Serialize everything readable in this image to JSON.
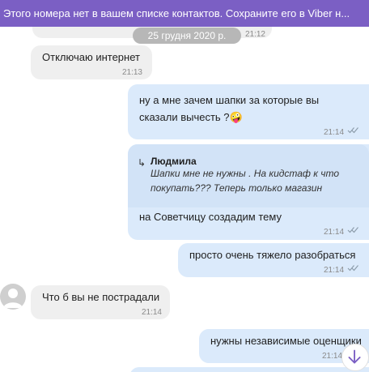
{
  "banner": {
    "text": "Этого номера нет в вашем списке контактов. Сохраните его в Viber н..."
  },
  "date_separator": "25 грудня 2020 р.",
  "messages": [
    {
      "direction": "in",
      "text": "",
      "time": "21:12"
    },
    {
      "direction": "in",
      "text": "Отключаю интернет",
      "time": "21:13"
    },
    {
      "direction": "out",
      "line1": "ну а мне зачем шапки за которые вы",
      "line2": "сказали вычесть ?",
      "emoji": "🤪",
      "time": "21:14"
    },
    {
      "direction": "out",
      "quote_author": "Людмила",
      "quote_text": "Шапки мне не нужны . На кидстаф к что покупать??? Теперь только магазин",
      "text": "на Советчицу создадим тему",
      "time": "21:14"
    },
    {
      "direction": "out",
      "text": "просто очень тяжело разобраться",
      "time": "21:14"
    },
    {
      "direction": "in",
      "text": "Что б вы не пострадали",
      "time": "21:14"
    },
    {
      "direction": "out",
      "text": "нужны независимые оценщики",
      "time": "21:14"
    }
  ],
  "colors": {
    "banner": "#7b5fc4",
    "incoming_bubble": "#efefef",
    "outgoing_bubble": "#dbeafb"
  },
  "icons": {
    "delivered": "double-check-icon",
    "scroll": "arrow-down-icon",
    "avatar": "person-icon",
    "reply": "reply-arrow-icon"
  }
}
